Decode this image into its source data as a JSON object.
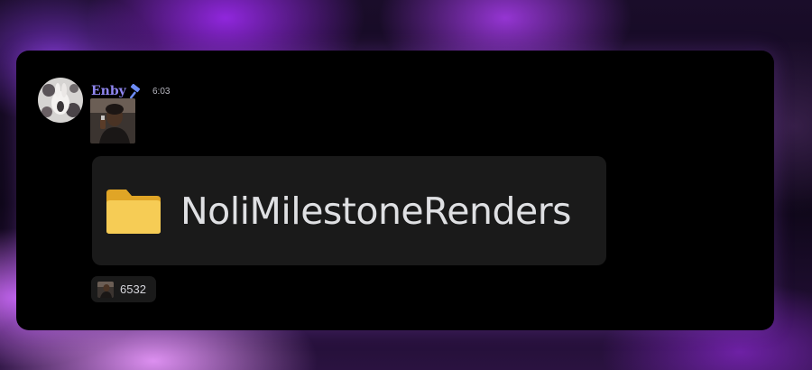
{
  "message": {
    "author": "Enby",
    "author_color": "#8f86f0",
    "role_icon": "hammer-icon",
    "timestamp": "6:03",
    "attachment": {
      "icon": "folder-icon",
      "file_name": "NoliMilestoneRenders"
    },
    "reaction": {
      "count": "6532"
    }
  }
}
